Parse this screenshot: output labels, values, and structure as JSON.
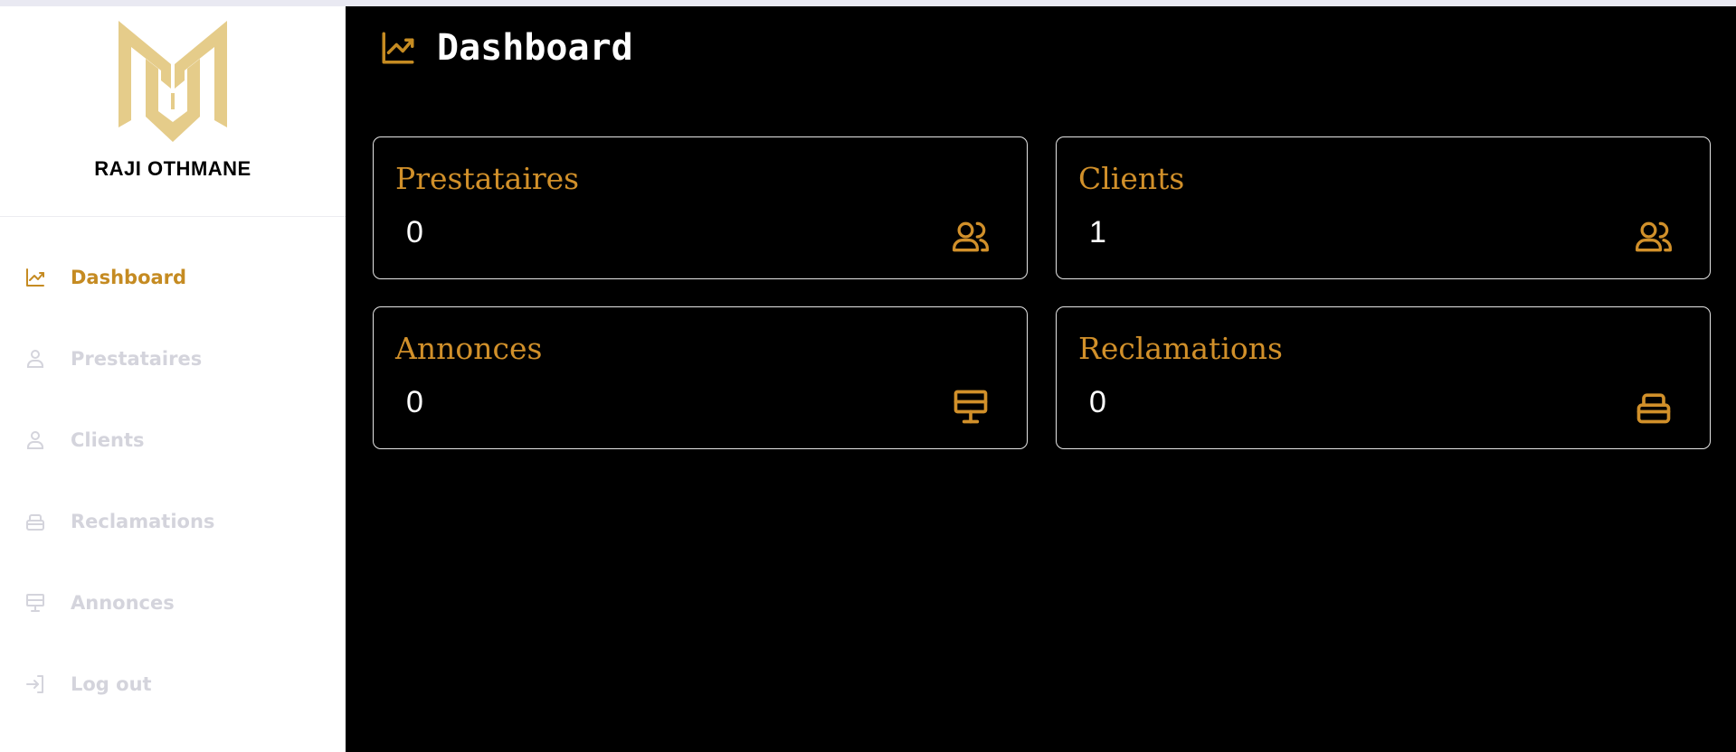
{
  "brand": {
    "name": "RAJI OTHMANE",
    "logo_icon": "m-monogram-logo",
    "logo_color": "#e5cc8a"
  },
  "sidebar": {
    "items": [
      {
        "label": "Dashboard",
        "icon": "chart-line-icon",
        "active": true
      },
      {
        "label": "Prestataires",
        "icon": "user-icon",
        "active": false
      },
      {
        "label": "Clients",
        "icon": "user-icon",
        "active": false
      },
      {
        "label": "Reclamations",
        "icon": "inbox-stack-icon",
        "active": false
      },
      {
        "label": "Annonces",
        "icon": "presentation-icon",
        "active": false
      },
      {
        "label": "Log out",
        "icon": "logout-icon",
        "active": false
      }
    ]
  },
  "header": {
    "title": "Dashboard",
    "icon": "chart-line-icon"
  },
  "cards": [
    {
      "title": "Prestataires",
      "value": "0",
      "icon": "users-icon"
    },
    {
      "title": "Clients",
      "value": "1",
      "icon": "users-icon"
    },
    {
      "title": "Annonces",
      "value": "0",
      "icon": "presentation-icon"
    },
    {
      "title": "Reclamations",
      "value": "0",
      "icon": "inbox-stack-icon"
    }
  ],
  "colors": {
    "accent": "#c58b22",
    "muted": "#d4d4dc",
    "background": "#000000",
    "card_border": "#e6e6e6"
  }
}
